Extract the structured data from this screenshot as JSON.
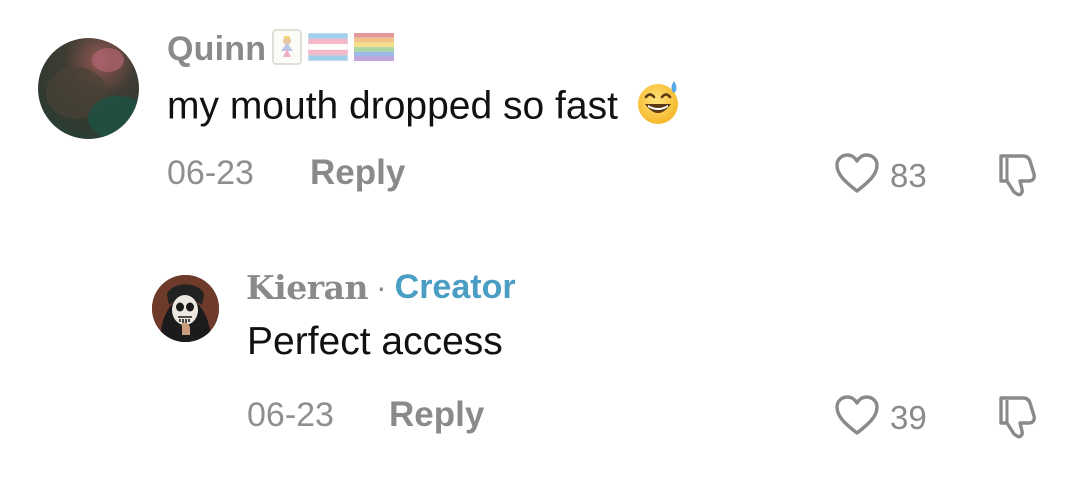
{
  "comments": [
    {
      "author": "Quinn",
      "text": "my mouth dropped so fast",
      "date": "06-23",
      "reply_label": "Reply",
      "likes": "83"
    },
    {
      "author": "Kieran",
      "separator": "·",
      "badge": "Creator",
      "text": "Perfect access",
      "date": "06-23",
      "reply_label": "Reply",
      "likes": "39"
    }
  ],
  "colors": {
    "meta_gray": "#8a8a8a",
    "creator_blue": "#4a9ec4",
    "text": "#111111"
  },
  "icons": {
    "like": "heart-outline-icon",
    "dislike": "thumbs-down-outline-icon",
    "emoji": "grinning-sweat-emoji",
    "badges": [
      "playing-card-badge",
      "trans-flag-badge",
      "rainbow-flag-badge"
    ]
  }
}
